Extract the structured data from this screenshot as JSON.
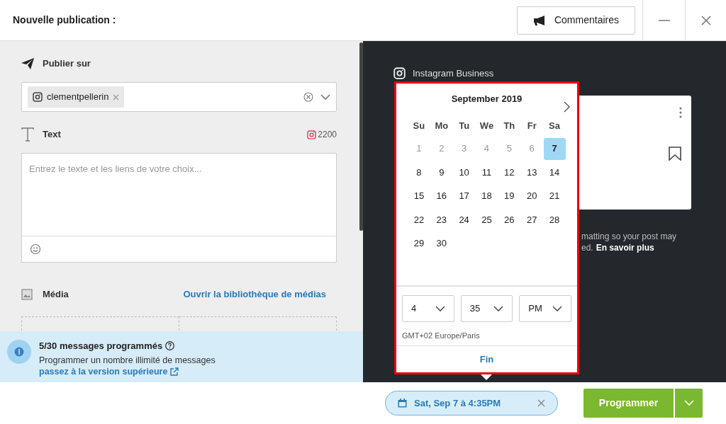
{
  "header": {
    "title": "Nouvelle publication :",
    "comments_button": "Commentaires"
  },
  "publish": {
    "label": "Publier sur",
    "accounts": [
      {
        "name": "clementpellerin"
      }
    ]
  },
  "text": {
    "label": "Text",
    "char_count": "2200",
    "placeholder": "Entrez le texte et les liens de votre choix..."
  },
  "media": {
    "label": "Média",
    "library_link": "Ouvrir la bibliothèque de médias"
  },
  "banner": {
    "title": "5/30 messages programmés",
    "message": "Programmer un nombre illimité de messages",
    "link": "passez à la version supérieure"
  },
  "preview": {
    "network": "Instagram Business",
    "notice_line_1": "matting so your post may",
    "notice_line_2": "ed.",
    "notice_link": "En savoir plus"
  },
  "calendar": {
    "month": "September 2019",
    "weekdays": [
      "Su",
      "Mo",
      "Tu",
      "We",
      "Th",
      "Fr",
      "Sa"
    ],
    "days": [
      {
        "label": "1",
        "disabled": true,
        "selected": false
      },
      {
        "label": "2",
        "disabled": true,
        "selected": false
      },
      {
        "label": "3",
        "disabled": true,
        "selected": false
      },
      {
        "label": "4",
        "disabled": true,
        "selected": false
      },
      {
        "label": "5",
        "disabled": true,
        "selected": false
      },
      {
        "label": "6",
        "disabled": true,
        "selected": false
      },
      {
        "label": "7",
        "disabled": false,
        "selected": true
      },
      {
        "label": "8",
        "disabled": false,
        "selected": false
      },
      {
        "label": "9",
        "disabled": false,
        "selected": false
      },
      {
        "label": "10",
        "disabled": false,
        "selected": false
      },
      {
        "label": "11",
        "disabled": false,
        "selected": false
      },
      {
        "label": "12",
        "disabled": false,
        "selected": false
      },
      {
        "label": "13",
        "disabled": false,
        "selected": false
      },
      {
        "label": "14",
        "disabled": false,
        "selected": false
      },
      {
        "label": "15",
        "disabled": false,
        "selected": false
      },
      {
        "label": "16",
        "disabled": false,
        "selected": false
      },
      {
        "label": "17",
        "disabled": false,
        "selected": false
      },
      {
        "label": "18",
        "disabled": false,
        "selected": false
      },
      {
        "label": "19",
        "disabled": false,
        "selected": false
      },
      {
        "label": "20",
        "disabled": false,
        "selected": false
      },
      {
        "label": "21",
        "disabled": false,
        "selected": false
      },
      {
        "label": "22",
        "disabled": false,
        "selected": false
      },
      {
        "label": "23",
        "disabled": false,
        "selected": false
      },
      {
        "label": "24",
        "disabled": false,
        "selected": false
      },
      {
        "label": "25",
        "disabled": false,
        "selected": false
      },
      {
        "label": "26",
        "disabled": false,
        "selected": false
      },
      {
        "label": "27",
        "disabled": false,
        "selected": false
      },
      {
        "label": "28",
        "disabled": false,
        "selected": false
      },
      {
        "label": "29",
        "disabled": false,
        "selected": false
      },
      {
        "label": "30",
        "disabled": false,
        "selected": false
      }
    ],
    "hour": "4",
    "minute": "35",
    "period": "PM",
    "timezone": "GMT+02 Europe/Paris",
    "done": "Fin"
  },
  "footer": {
    "schedule": "Sat, Sep 7 à 4:35PM",
    "submit": "Programmer"
  }
}
